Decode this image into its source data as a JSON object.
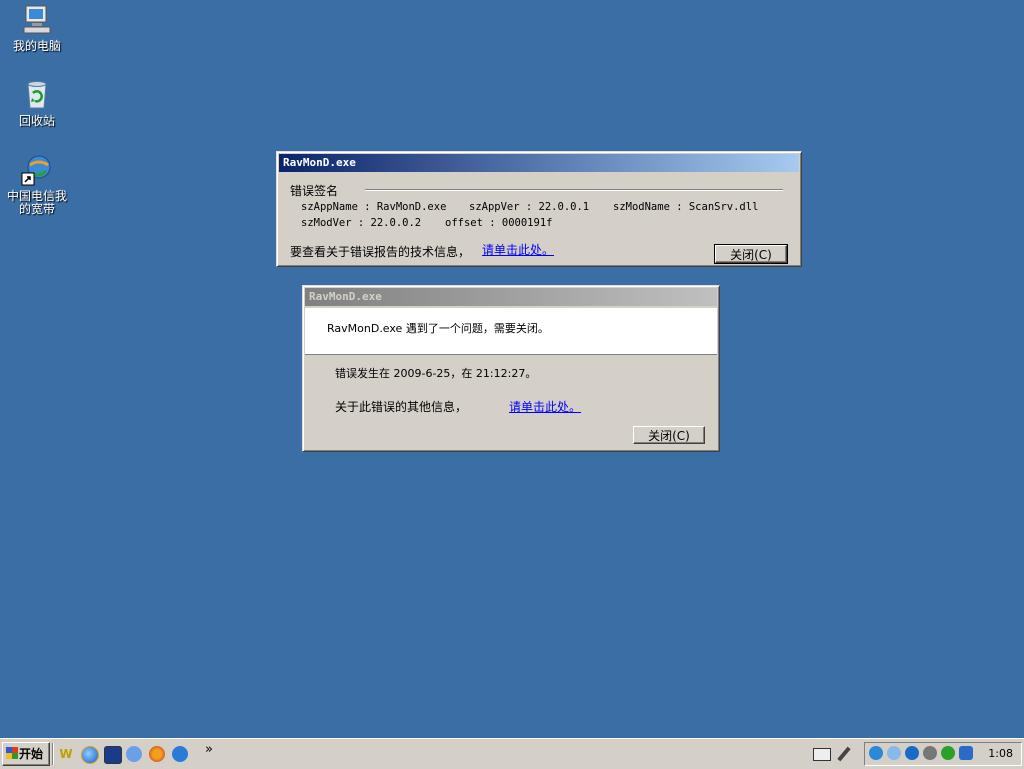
{
  "desktop": {
    "icons": [
      {
        "label": "我的电脑"
      },
      {
        "label": "回收站"
      },
      {
        "label_line1": "中国电信我",
        "label_line2": "的宽带"
      }
    ]
  },
  "dialog1": {
    "title": "RavMonD.exe",
    "section_label": "错误签名",
    "app_name": "szAppName : RavMonD.exe",
    "app_ver": "szAppVer : 22.0.0.1",
    "mod_name": "szModName : ScanSrv.dll",
    "mod_ver": "szModVer : 22.0.0.2",
    "offset": "offset : 0000191f",
    "info_text": "要查看关于错误报告的技术信息，",
    "link_text": "请单击此处。",
    "close_label": "关闭(C)"
  },
  "dialog2": {
    "title": "RavMonD.exe",
    "message": "RavMonD.exe 遇到了一个问题，需要关闭。",
    "time_text": "错误发生在 2009-6-25，在 21:12:27。",
    "more_text": "关于此错误的其他信息，",
    "link_text": "请单击此处。",
    "close_label": "关闭(C)"
  },
  "taskbar": {
    "start_label": "开始",
    "chevron": "»",
    "clock": "1:08"
  }
}
